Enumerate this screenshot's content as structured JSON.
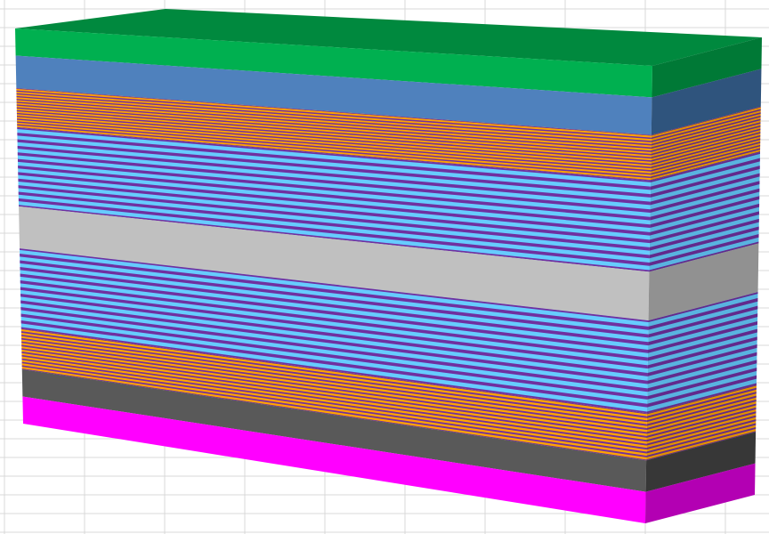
{
  "background": {
    "color": "#ffffff",
    "gridline_color": "#d9d9d9",
    "grid": true
  },
  "layer_stack": {
    "description_visible": false,
    "layers_top_to_bottom": [
      {
        "id": "top-contact",
        "pattern": "solid",
        "front_color": "#00b050",
        "side_color": "#008a3e",
        "top_color": "#00893e",
        "relative_thickness": 1.0
      },
      {
        "id": "blue-layer",
        "pattern": "solid",
        "front_color": "#4f81bd",
        "side_color": "#36608f",
        "relative_thickness": 1.2
      },
      {
        "id": "upper-orange-superlattice",
        "pattern": "striped",
        "stripe_colors": [
          "#ffa500",
          "#7030a0"
        ],
        "stripe_count": 14,
        "relative_thickness": 1.45
      },
      {
        "id": "upper-cyan-superlattice",
        "pattern": "striped",
        "stripe_colors": [
          "#66ccff",
          "#7030a0"
        ],
        "stripe_count": 12,
        "relative_thickness": 2.9
      },
      {
        "id": "gray-layer",
        "pattern": "solid",
        "front_color": "#c0c0c0",
        "side_color": "#a6a6a6",
        "relative_thickness": 1.55
      },
      {
        "id": "lower-cyan-superlattice",
        "pattern": "striped",
        "stripe_colors": [
          "#66ccff",
          "#7030a0"
        ],
        "stripe_count": 12,
        "relative_thickness": 2.95
      },
      {
        "id": "lower-orange-superlattice",
        "pattern": "striped",
        "stripe_colors": [
          "#ffa500",
          "#7030a0"
        ],
        "stripe_count": 12,
        "relative_thickness": 1.5
      },
      {
        "id": "dark-gray-layer",
        "pattern": "solid",
        "front_color": "#595959",
        "side_color": "#3f3f3f",
        "relative_thickness": 1.0
      },
      {
        "id": "bottom-contact",
        "pattern": "solid",
        "front_color": "#ff00ff",
        "side_color": "#cc00cc",
        "relative_thickness": 1.0
      }
    ]
  }
}
